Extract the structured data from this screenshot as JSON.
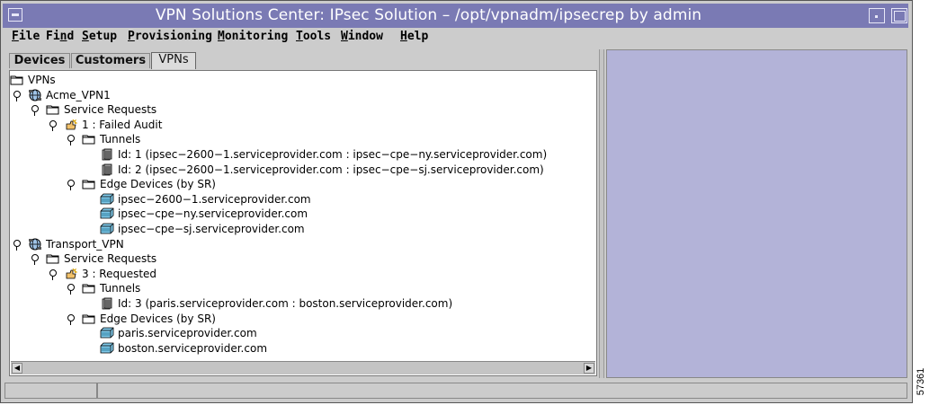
{
  "window": {
    "title": "VPN Solutions Center: IPsec Solution – /opt/vpnadm/ipsecrep by admin"
  },
  "menu": [
    {
      "ul": "F",
      "rest": "ile"
    },
    {
      "ul": "",
      "pre": "Fi",
      "ulmid": "n",
      "rest": "d"
    },
    {
      "ul": "S",
      "rest": "etup"
    },
    {
      "ul": "P",
      "rest": "rovisioning"
    },
    {
      "ul": "M",
      "rest": "onitoring"
    },
    {
      "ul": "T",
      "rest": "ools"
    },
    {
      "ul": "W",
      "rest": "indow"
    },
    {
      "ul": "H",
      "rest": "elp"
    }
  ],
  "tabs": [
    {
      "label": "Devices",
      "active": false
    },
    {
      "label": "Customers",
      "active": false
    },
    {
      "label": "VPNs",
      "active": true
    }
  ],
  "tree": [
    {
      "label": "VPNs",
      "icon": "folder-icon",
      "handle": false,
      "depth": 0
    },
    {
      "label": "Acme_VPN1",
      "icon": "vpn-network-icon",
      "handle": true,
      "depth": 0
    },
    {
      "label": "Service Requests",
      "icon": "folder-icon",
      "handle": true,
      "depth": 1
    },
    {
      "label": "1 : Failed Audit",
      "icon": "service-request-icon",
      "handle": true,
      "depth": 2
    },
    {
      "label": "Tunnels",
      "icon": "folder-icon",
      "handle": true,
      "depth": 3
    },
    {
      "label": "Id: 1 (ipsec−2600−1.serviceprovider.com : ipsec−cpe−ny.serviceprovider.com)",
      "icon": "tunnel-icon",
      "handle": false,
      "depth": 4
    },
    {
      "label": "Id: 2 (ipsec−2600−1.serviceprovider.com : ipsec−cpe−sj.serviceprovider.com)",
      "icon": "tunnel-icon",
      "handle": false,
      "depth": 4
    },
    {
      "label": "Edge Devices (by SR)",
      "icon": "folder-icon",
      "handle": true,
      "depth": 3
    },
    {
      "label": "ipsec−2600−1.serviceprovider.com",
      "icon": "router-icon",
      "handle": false,
      "depth": 4
    },
    {
      "label": "ipsec−cpe−ny.serviceprovider.com",
      "icon": "router-icon",
      "handle": false,
      "depth": 4
    },
    {
      "label": "ipsec−cpe−sj.serviceprovider.com",
      "icon": "router-icon",
      "handle": false,
      "depth": 4
    },
    {
      "label": "Transport_VPN",
      "icon": "vpn-network-icon",
      "handle": true,
      "depth": 0
    },
    {
      "label": "Service Requests",
      "icon": "folder-icon",
      "handle": true,
      "depth": 1
    },
    {
      "label": "3 : Requested",
      "icon": "service-request-icon",
      "handle": true,
      "depth": 2
    },
    {
      "label": "Tunnels",
      "icon": "folder-icon",
      "handle": true,
      "depth": 3
    },
    {
      "label": "Id: 3 (paris.serviceprovider.com : boston.serviceprovider.com)",
      "icon": "tunnel-icon",
      "handle": false,
      "depth": 4
    },
    {
      "label": "Edge Devices (by SR)",
      "icon": "folder-icon",
      "handle": true,
      "depth": 3
    },
    {
      "label": "paris.serviceprovider.com",
      "icon": "router-icon",
      "handle": false,
      "depth": 4
    },
    {
      "label": "boston.serviceprovider.com",
      "icon": "router-icon",
      "handle": false,
      "depth": 4
    }
  ],
  "figure_id": "57361",
  "colors": {
    "titlebar": "#7a7ab4",
    "right_pane": "#b3b3d8",
    "chrome": "#cccccc"
  }
}
